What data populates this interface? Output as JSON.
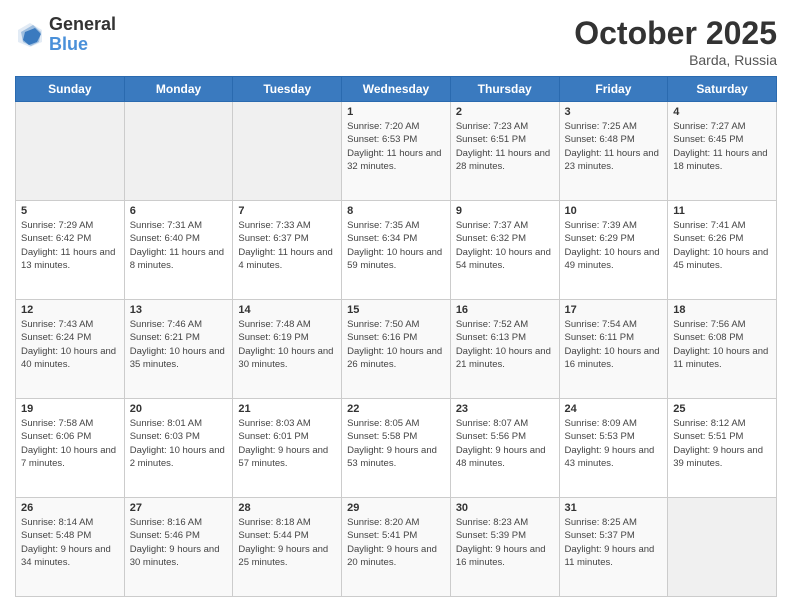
{
  "logo": {
    "general": "General",
    "blue": "Blue"
  },
  "header": {
    "month": "October 2025",
    "location": "Barda, Russia"
  },
  "days_of_week": [
    "Sunday",
    "Monday",
    "Tuesday",
    "Wednesday",
    "Thursday",
    "Friday",
    "Saturday"
  ],
  "weeks": [
    [
      {
        "day": "",
        "sunrise": "",
        "sunset": "",
        "daylight": ""
      },
      {
        "day": "",
        "sunrise": "",
        "sunset": "",
        "daylight": ""
      },
      {
        "day": "",
        "sunrise": "",
        "sunset": "",
        "daylight": ""
      },
      {
        "day": "1",
        "sunrise": "Sunrise: 7:20 AM",
        "sunset": "Sunset: 6:53 PM",
        "daylight": "Daylight: 11 hours and 32 minutes."
      },
      {
        "day": "2",
        "sunrise": "Sunrise: 7:23 AM",
        "sunset": "Sunset: 6:51 PM",
        "daylight": "Daylight: 11 hours and 28 minutes."
      },
      {
        "day": "3",
        "sunrise": "Sunrise: 7:25 AM",
        "sunset": "Sunset: 6:48 PM",
        "daylight": "Daylight: 11 hours and 23 minutes."
      },
      {
        "day": "4",
        "sunrise": "Sunrise: 7:27 AM",
        "sunset": "Sunset: 6:45 PM",
        "daylight": "Daylight: 11 hours and 18 minutes."
      }
    ],
    [
      {
        "day": "5",
        "sunrise": "Sunrise: 7:29 AM",
        "sunset": "Sunset: 6:42 PM",
        "daylight": "Daylight: 11 hours and 13 minutes."
      },
      {
        "day": "6",
        "sunrise": "Sunrise: 7:31 AM",
        "sunset": "Sunset: 6:40 PM",
        "daylight": "Daylight: 11 hours and 8 minutes."
      },
      {
        "day": "7",
        "sunrise": "Sunrise: 7:33 AM",
        "sunset": "Sunset: 6:37 PM",
        "daylight": "Daylight: 11 hours and 4 minutes."
      },
      {
        "day": "8",
        "sunrise": "Sunrise: 7:35 AM",
        "sunset": "Sunset: 6:34 PM",
        "daylight": "Daylight: 10 hours and 59 minutes."
      },
      {
        "day": "9",
        "sunrise": "Sunrise: 7:37 AM",
        "sunset": "Sunset: 6:32 PM",
        "daylight": "Daylight: 10 hours and 54 minutes."
      },
      {
        "day": "10",
        "sunrise": "Sunrise: 7:39 AM",
        "sunset": "Sunset: 6:29 PM",
        "daylight": "Daylight: 10 hours and 49 minutes."
      },
      {
        "day": "11",
        "sunrise": "Sunrise: 7:41 AM",
        "sunset": "Sunset: 6:26 PM",
        "daylight": "Daylight: 10 hours and 45 minutes."
      }
    ],
    [
      {
        "day": "12",
        "sunrise": "Sunrise: 7:43 AM",
        "sunset": "Sunset: 6:24 PM",
        "daylight": "Daylight: 10 hours and 40 minutes."
      },
      {
        "day": "13",
        "sunrise": "Sunrise: 7:46 AM",
        "sunset": "Sunset: 6:21 PM",
        "daylight": "Daylight: 10 hours and 35 minutes."
      },
      {
        "day": "14",
        "sunrise": "Sunrise: 7:48 AM",
        "sunset": "Sunset: 6:19 PM",
        "daylight": "Daylight: 10 hours and 30 minutes."
      },
      {
        "day": "15",
        "sunrise": "Sunrise: 7:50 AM",
        "sunset": "Sunset: 6:16 PM",
        "daylight": "Daylight: 10 hours and 26 minutes."
      },
      {
        "day": "16",
        "sunrise": "Sunrise: 7:52 AM",
        "sunset": "Sunset: 6:13 PM",
        "daylight": "Daylight: 10 hours and 21 minutes."
      },
      {
        "day": "17",
        "sunrise": "Sunrise: 7:54 AM",
        "sunset": "Sunset: 6:11 PM",
        "daylight": "Daylight: 10 hours and 16 minutes."
      },
      {
        "day": "18",
        "sunrise": "Sunrise: 7:56 AM",
        "sunset": "Sunset: 6:08 PM",
        "daylight": "Daylight: 10 hours and 11 minutes."
      }
    ],
    [
      {
        "day": "19",
        "sunrise": "Sunrise: 7:58 AM",
        "sunset": "Sunset: 6:06 PM",
        "daylight": "Daylight: 10 hours and 7 minutes."
      },
      {
        "day": "20",
        "sunrise": "Sunrise: 8:01 AM",
        "sunset": "Sunset: 6:03 PM",
        "daylight": "Daylight: 10 hours and 2 minutes."
      },
      {
        "day": "21",
        "sunrise": "Sunrise: 8:03 AM",
        "sunset": "Sunset: 6:01 PM",
        "daylight": "Daylight: 9 hours and 57 minutes."
      },
      {
        "day": "22",
        "sunrise": "Sunrise: 8:05 AM",
        "sunset": "Sunset: 5:58 PM",
        "daylight": "Daylight: 9 hours and 53 minutes."
      },
      {
        "day": "23",
        "sunrise": "Sunrise: 8:07 AM",
        "sunset": "Sunset: 5:56 PM",
        "daylight": "Daylight: 9 hours and 48 minutes."
      },
      {
        "day": "24",
        "sunrise": "Sunrise: 8:09 AM",
        "sunset": "Sunset: 5:53 PM",
        "daylight": "Daylight: 9 hours and 43 minutes."
      },
      {
        "day": "25",
        "sunrise": "Sunrise: 8:12 AM",
        "sunset": "Sunset: 5:51 PM",
        "daylight": "Daylight: 9 hours and 39 minutes."
      }
    ],
    [
      {
        "day": "26",
        "sunrise": "Sunrise: 8:14 AM",
        "sunset": "Sunset: 5:48 PM",
        "daylight": "Daylight: 9 hours and 34 minutes."
      },
      {
        "day": "27",
        "sunrise": "Sunrise: 8:16 AM",
        "sunset": "Sunset: 5:46 PM",
        "daylight": "Daylight: 9 hours and 30 minutes."
      },
      {
        "day": "28",
        "sunrise": "Sunrise: 8:18 AM",
        "sunset": "Sunset: 5:44 PM",
        "daylight": "Daylight: 9 hours and 25 minutes."
      },
      {
        "day": "29",
        "sunrise": "Sunrise: 8:20 AM",
        "sunset": "Sunset: 5:41 PM",
        "daylight": "Daylight: 9 hours and 20 minutes."
      },
      {
        "day": "30",
        "sunrise": "Sunrise: 8:23 AM",
        "sunset": "Sunset: 5:39 PM",
        "daylight": "Daylight: 9 hours and 16 minutes."
      },
      {
        "day": "31",
        "sunrise": "Sunrise: 8:25 AM",
        "sunset": "Sunset: 5:37 PM",
        "daylight": "Daylight: 9 hours and 11 minutes."
      },
      {
        "day": "",
        "sunrise": "",
        "sunset": "",
        "daylight": ""
      }
    ]
  ]
}
